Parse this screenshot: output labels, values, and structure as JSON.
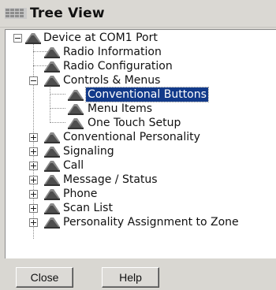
{
  "window": {
    "title": "Tree View",
    "icon": "grid-window-icon"
  },
  "tree": {
    "root": {
      "label": "Device at COM1 Port",
      "expanded": true,
      "icon": "radio-device-icon"
    },
    "items": [
      {
        "label": "Radio Information",
        "level": 1,
        "expander": "none"
      },
      {
        "label": "Radio Configuration",
        "level": 1,
        "expander": "none"
      },
      {
        "label": "Controls & Menus",
        "level": 1,
        "expander": "minus"
      },
      {
        "label": "Conventional Buttons",
        "level": 2,
        "expander": "none",
        "selected": true
      },
      {
        "label": "Menu Items",
        "level": 2,
        "expander": "none"
      },
      {
        "label": "One Touch Setup",
        "level": 2,
        "expander": "none"
      },
      {
        "label": "Conventional Personality",
        "level": 1,
        "expander": "plus"
      },
      {
        "label": "Signaling",
        "level": 1,
        "expander": "plus"
      },
      {
        "label": "Call",
        "level": 1,
        "expander": "plus"
      },
      {
        "label": "Message / Status",
        "level": 1,
        "expander": "plus"
      },
      {
        "label": "Phone",
        "level": 1,
        "expander": "plus"
      },
      {
        "label": "Scan List",
        "level": 1,
        "expander": "plus"
      },
      {
        "label": "Personality Assignment to Zone",
        "level": 1,
        "expander": "plus"
      }
    ]
  },
  "buttons": {
    "close": "Close",
    "help": "Help"
  },
  "colors": {
    "selection_bg": "#123a8a",
    "window_bg": "#d9d7d2",
    "tree_bg": "#ffffff"
  }
}
